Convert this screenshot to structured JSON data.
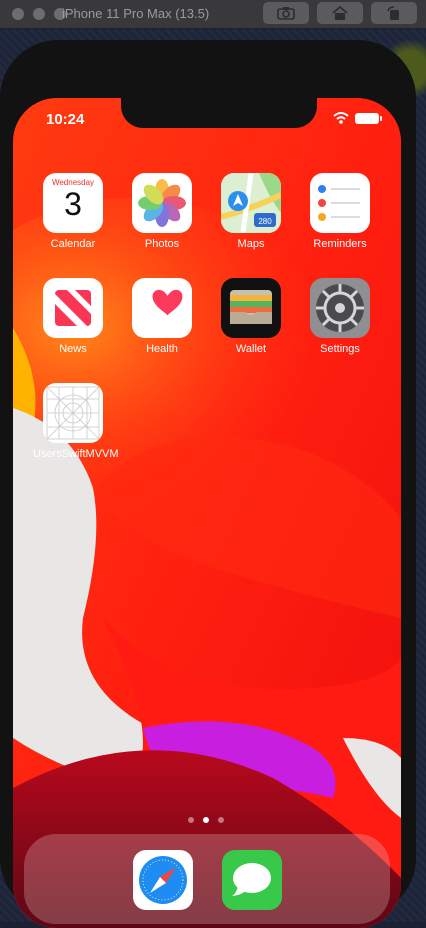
{
  "window": {
    "title": "iPhone 11 Pro Max (13.5)",
    "toolbar_icons": [
      "screenshot-icon",
      "home-icon",
      "rotate-icon"
    ]
  },
  "status_bar": {
    "time": "10:24",
    "icons": [
      "wifi-icon",
      "battery-icon"
    ]
  },
  "home_screen": {
    "apps": [
      {
        "label": "Calendar",
        "icon": "calendar-icon",
        "calendar_day": "Wednesday",
        "calendar_date": "3"
      },
      {
        "label": "Photos",
        "icon": "photos-icon"
      },
      {
        "label": "Maps",
        "icon": "maps-icon",
        "highway_number": "280"
      },
      {
        "label": "Reminders",
        "icon": "reminders-icon"
      },
      {
        "label": "News",
        "icon": "news-icon"
      },
      {
        "label": "Health",
        "icon": "health-icon"
      },
      {
        "label": "Wallet",
        "icon": "wallet-icon"
      },
      {
        "label": "Settings",
        "icon": "settings-icon"
      },
      {
        "label": "UsersSwiftMVVM",
        "icon": "app-placeholder-icon"
      }
    ],
    "page_indicator": {
      "pages": 3,
      "current": 2
    },
    "dock": [
      {
        "name": "Safari",
        "icon": "safari-icon"
      },
      {
        "name": "Messages",
        "icon": "messages-icon"
      }
    ]
  },
  "colors": {
    "wallpaper_red": "#ff2a10",
    "wallpaper_magenta": "#c81ee0",
    "wallpaper_white": "#e9e6e6",
    "wallpaper_yellow": "#ffb300"
  }
}
